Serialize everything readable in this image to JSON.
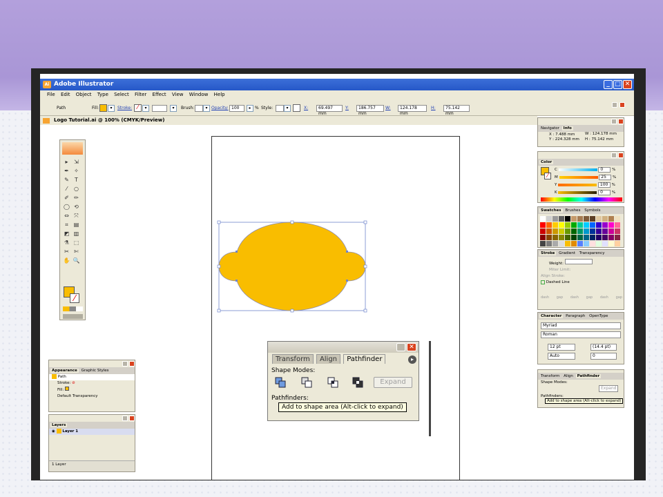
{
  "window": {
    "app_title": "Adobe Illustrator",
    "logo": "Ai"
  },
  "menu": [
    "File",
    "Edit",
    "Object",
    "Type",
    "Select",
    "Filter",
    "Effect",
    "View",
    "Window",
    "Help"
  ],
  "options": {
    "selection": "Path",
    "fill_label": "Fill:",
    "stroke_label": "Stroke:",
    "brush_label": "Brush:",
    "opacity_label": "Opacity:",
    "opacity_value": "100",
    "percent": "%",
    "style_label": "Style:",
    "x_label": "X:",
    "x_value": "69.497 mm",
    "y_label": "Y:",
    "y_value": "186.757 mm",
    "w_label": "W:",
    "w_value": "124.178 mm",
    "h_label": "H:",
    "h_value": "75.142 mm"
  },
  "document": {
    "title": "Logo Tutorial.ai @ 100% (CMYK/Preview)"
  },
  "colors": {
    "fill": "#f9bd00",
    "accent": "#2658c8",
    "close": "#d9431f"
  },
  "toolbox": {
    "tools": [
      "▸",
      "⇲",
      "✒",
      "✧",
      "✎",
      "T",
      "⁄",
      "○",
      "✐",
      "✏",
      "◯",
      "⟲",
      "⇔",
      "⤧",
      "⌗",
      "▤",
      "◩",
      "▥",
      "⚗",
      "⬚",
      "✂",
      "✄",
      "✋",
      "🔍"
    ]
  },
  "appearance": {
    "tabs": [
      "Appearance",
      "Graphic Styles"
    ],
    "item": "Path",
    "stroke_label": "Stroke:",
    "fill_label": "Fill:",
    "transparency": "Default Transparency"
  },
  "layers": {
    "tab": "Layers",
    "layer_name": "Layer 1",
    "count": "1 Layer"
  },
  "navigator": {
    "tabs": [
      "Navigator",
      "Info"
    ],
    "x": "X : 7.488 mm",
    "y": "Y : 224.328 mm",
    "w": "W : 124.178 mm",
    "h": "H : 75.142 mm"
  },
  "color_panel": {
    "tab": "Color",
    "channels": [
      {
        "name": "C",
        "value": "0",
        "pct": "%"
      },
      {
        "name": "M",
        "value": "25",
        "pct": "%"
      },
      {
        "name": "Y",
        "value": "100",
        "pct": "%"
      },
      {
        "name": "K",
        "value": "0",
        "pct": "%"
      }
    ]
  },
  "swatches": {
    "tabs": [
      "Swatches",
      "Brushes",
      "Symbols"
    ],
    "colors": [
      "#ffffff",
      "#d0d0d0",
      "#9a9a9a",
      "#5f5f5f",
      "#000000",
      "#c59a6a",
      "#a67c52",
      "#7d5b3a",
      "#5c3e24",
      "#e0c8a0",
      "#d0b080",
      "#b08050",
      "#f0e0c0",
      "#ff0000",
      "#ff6600",
      "#ffcc00",
      "#ffff00",
      "#99cc00",
      "#00aa00",
      "#00cc99",
      "#00ccff",
      "#0066ff",
      "#3300cc",
      "#9900cc",
      "#ff00cc",
      "#ff6699",
      "#cc0000",
      "#cc5500",
      "#cc9900",
      "#cccc00",
      "#669900",
      "#006600",
      "#009966",
      "#0099cc",
      "#003399",
      "#330099",
      "#660099",
      "#cc0099",
      "#cc3366",
      "#880000",
      "#884400",
      "#886600",
      "#888800",
      "#446600",
      "#004400",
      "#006644",
      "#006688",
      "#002266",
      "#220066",
      "#440066",
      "#880066",
      "#882244",
      "#444444",
      "#7a7a7a",
      "#aaaaaa",
      "#dddddd",
      "#f9bd00",
      "#e08a00",
      "#5580ff",
      "#88ccff",
      "#ffe0e0",
      "#e0ffe0",
      "#e0e0ff",
      "#fffbd0",
      "#ffd0a0"
    ]
  },
  "stroke_panel": {
    "tabs": [
      "Stroke",
      "Gradient",
      "Transparency"
    ],
    "weight_label": "Weight:",
    "miter_label": "Miter Limit:",
    "align_label": "Align Stroke:",
    "dashed_label": "Dashed Line",
    "dash_labels": [
      "dash",
      "gap",
      "dash",
      "gap",
      "dash",
      "gap"
    ]
  },
  "character": {
    "tabs": [
      "Character",
      "Paragraph",
      "OpenType"
    ],
    "font": "Myriad",
    "style": "Roman",
    "size": "12 pt",
    "leading": "(14.4 pt)",
    "tracking_auto": "Auto",
    "kerning": "0"
  },
  "pathfinder_small": {
    "tabs": [
      "Transform",
      "Align",
      "Pathfinder"
    ],
    "shape_modes": "Shape Modes:",
    "expand": "Expand",
    "pathfinders": "Pathfinders:",
    "tooltip": "Add to shape area (Alt-click to expand)"
  },
  "pathfinder_big": {
    "tabs": [
      "Transform",
      "Align",
      "Pathfinder"
    ],
    "shape_modes": "Shape Modes:",
    "expand": "Expand",
    "pathfinders": "Pathfinders:",
    "tooltip": "Add to shape area (Alt-click to expand)"
  }
}
